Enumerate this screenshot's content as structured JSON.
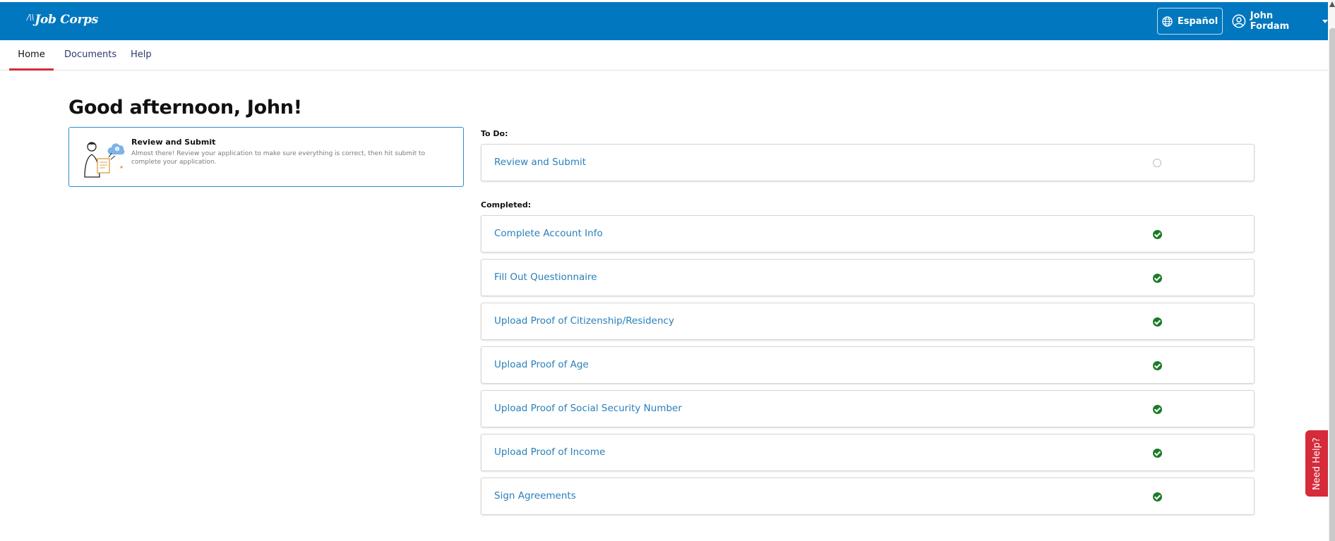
{
  "header": {
    "brand": "Job Corps",
    "brand_mark": "/\\\\",
    "language_button": "Español",
    "user_name": "John Fordam",
    "bar_color": "#0077bf"
  },
  "nav": {
    "tabs": [
      {
        "label": "Home",
        "active": true
      },
      {
        "label": "Documents",
        "active": false
      },
      {
        "label": "Help",
        "active": false
      }
    ]
  },
  "greeting": "Good afternoon, John!",
  "current_step_card": {
    "title": "Review and Submit",
    "description": "Almost there! Review your application to make sure everything is correct, then hit submit to complete your application."
  },
  "todo": {
    "label": "To Do:",
    "items": [
      {
        "label": "Review and Submit",
        "status": "pending"
      }
    ]
  },
  "completed": {
    "label": "Completed:",
    "items": [
      {
        "label": "Complete Account Info",
        "status": "done"
      },
      {
        "label": "Fill Out Questionnaire",
        "status": "done"
      },
      {
        "label": "Upload Proof of Citizenship/Residency",
        "status": "done"
      },
      {
        "label": "Upload Proof of Age",
        "status": "done"
      },
      {
        "label": "Upload Proof of Social Security Number",
        "status": "done"
      },
      {
        "label": "Upload Proof of Income",
        "status": "done"
      },
      {
        "label": "Sign Agreements",
        "status": "done"
      }
    ]
  },
  "help_tab": "Need Help?",
  "colors": {
    "accent_red": "#d52b3b",
    "link_blue": "#2a7fba",
    "done_green": "#1d7a2a"
  }
}
